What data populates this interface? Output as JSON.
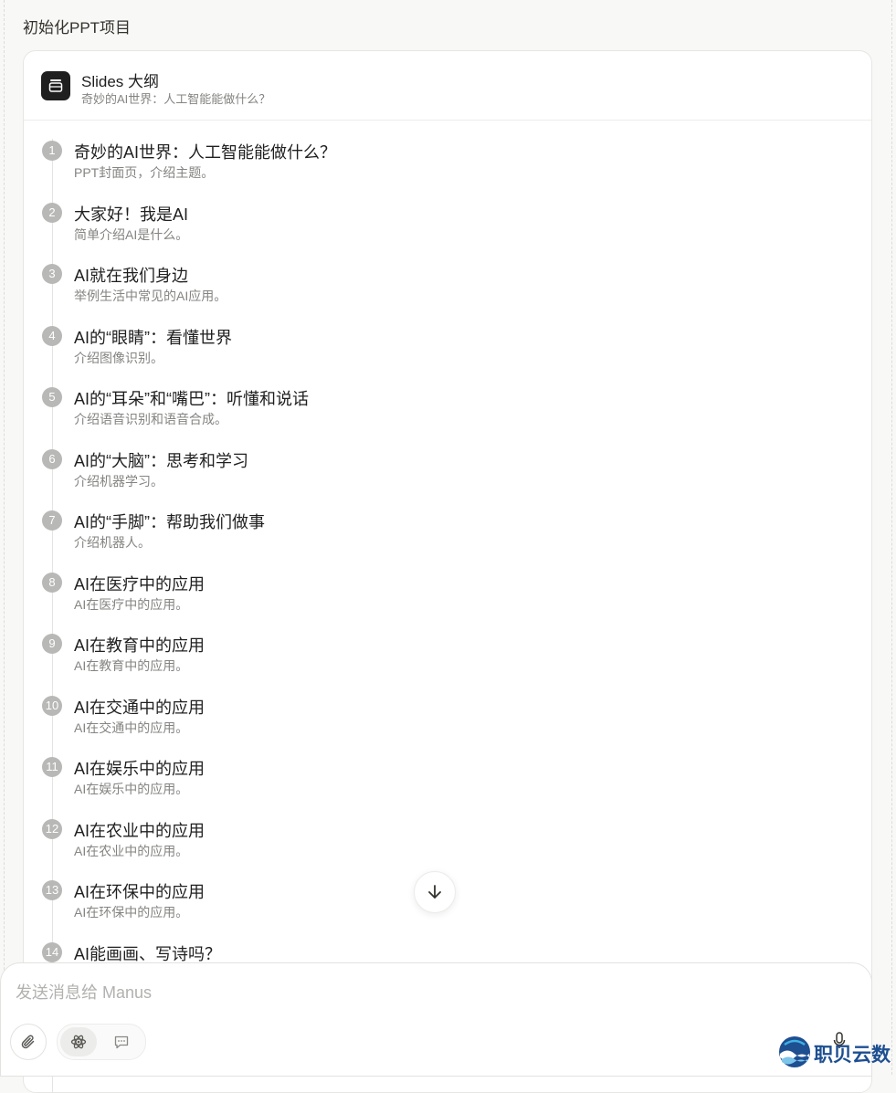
{
  "step": {
    "title": "初始化PPT项目"
  },
  "card": {
    "title": "Slides 大纲",
    "subtitle": "奇妙的AI世界：人工智能能做什么？",
    "icon": "slides-icon"
  },
  "outline": [
    {
      "num": "1",
      "title": "奇妙的AI世界：人工智能能做什么？",
      "desc": "PPT封面页，介绍主题。"
    },
    {
      "num": "2",
      "title": "大家好！我是AI",
      "desc": "简单介绍AI是什么。"
    },
    {
      "num": "3",
      "title": "AI就在我们身边",
      "desc": "举例生活中常见的AI应用。"
    },
    {
      "num": "4",
      "title": "AI的“眼睛”：看懂世界",
      "desc": "介绍图像识别。"
    },
    {
      "num": "5",
      "title": "AI的“耳朵”和“嘴巴”：听懂和说话",
      "desc": "介绍语音识别和语音合成。"
    },
    {
      "num": "6",
      "title": "AI的“大脑”：思考和学习",
      "desc": "介绍机器学习。"
    },
    {
      "num": "7",
      "title": "AI的“手脚”：帮助我们做事",
      "desc": "介绍机器人。"
    },
    {
      "num": "8",
      "title": "AI在医疗中的应用",
      "desc": "AI在医疗中的应用。"
    },
    {
      "num": "9",
      "title": "AI在教育中的应用",
      "desc": "AI在教育中的应用。"
    },
    {
      "num": "10",
      "title": "AI在交通中的应用",
      "desc": "AI在交通中的应用。"
    },
    {
      "num": "11",
      "title": "AI在娱乐中的应用",
      "desc": "AI在娱乐中的应用。"
    },
    {
      "num": "12",
      "title": "AI在农业中的应用",
      "desc": "AI在农业中的应用。"
    },
    {
      "num": "13",
      "title": "AI在环保中的应用",
      "desc": "AI在环保中的应用。"
    },
    {
      "num": "14",
      "title": "AI能画画、写诗吗？",
      "desc": ""
    }
  ],
  "composer": {
    "placeholder": "发送消息给 Manus",
    "icons": [
      "paperclip-icon",
      "atom-icon",
      "chat-bubble-icon",
      "microphone-icon",
      "arrow-down-icon"
    ]
  },
  "watermark": {
    "text": "职贝云数"
  },
  "colors": {
    "text": "#34322d",
    "muted": "#858481",
    "badge": "#b8b8b6",
    "card_border": "#e6e6e4",
    "brand": "#1d4f91"
  }
}
